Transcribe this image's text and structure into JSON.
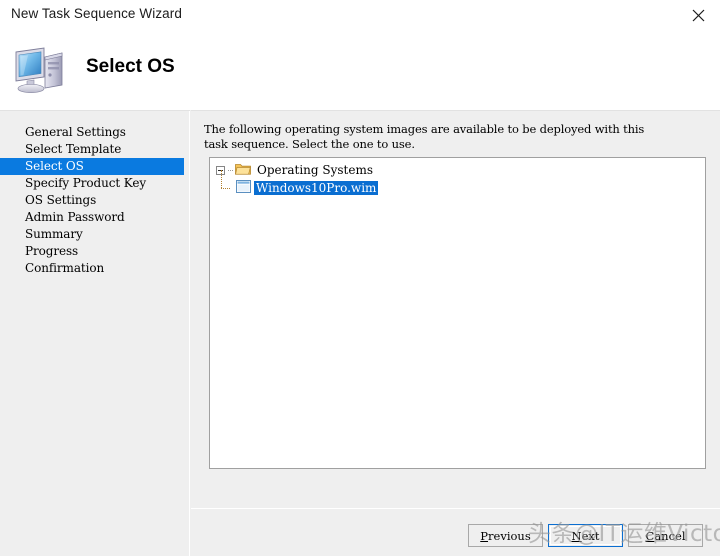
{
  "window": {
    "title": "New Task Sequence Wizard",
    "close_icon": "close-icon"
  },
  "header": {
    "icon": "computer-icon",
    "page_title": "Select OS"
  },
  "sidebar": {
    "items": [
      {
        "label": "General Settings",
        "selected": false
      },
      {
        "label": "Select Template",
        "selected": false
      },
      {
        "label": "Select OS",
        "selected": true
      },
      {
        "label": "Specify Product Key",
        "selected": false
      },
      {
        "label": "OS Settings",
        "selected": false
      },
      {
        "label": "Admin Password",
        "selected": false
      },
      {
        "label": "Summary",
        "selected": false
      },
      {
        "label": "Progress",
        "selected": false
      },
      {
        "label": "Confirmation",
        "selected": false
      }
    ]
  },
  "main": {
    "intro_text": "The following operating system images are available to be deployed with this\ntask sequence.  Select the one to use.",
    "tree": {
      "root": {
        "label": "Operating Systems",
        "icon": "folder-icon",
        "expanded": true,
        "expander_icon": "minus-box-icon",
        "selected": false
      },
      "children": [
        {
          "label": "Windows10Pro.wim",
          "icon": "wim-file-icon",
          "selected": true
        }
      ]
    }
  },
  "footer": {
    "buttons": [
      {
        "name": "previous",
        "label_before": "",
        "accel": "P",
        "label_after": "revious",
        "focused": false
      },
      {
        "name": "next",
        "label_before": "",
        "accel": "N",
        "label_after": "ext",
        "focused": true
      },
      {
        "name": "cancel",
        "label_before": "",
        "accel": "C",
        "label_after": "ancel",
        "focused": false
      }
    ]
  },
  "watermark": {
    "text": "头条@IT运维Victor"
  },
  "colors": {
    "selection_blue": "#0a7ae0",
    "tree_selection_blue": "#0a6ed1",
    "panel_gray": "#efefef",
    "border_gray": "#a0a0a0"
  }
}
